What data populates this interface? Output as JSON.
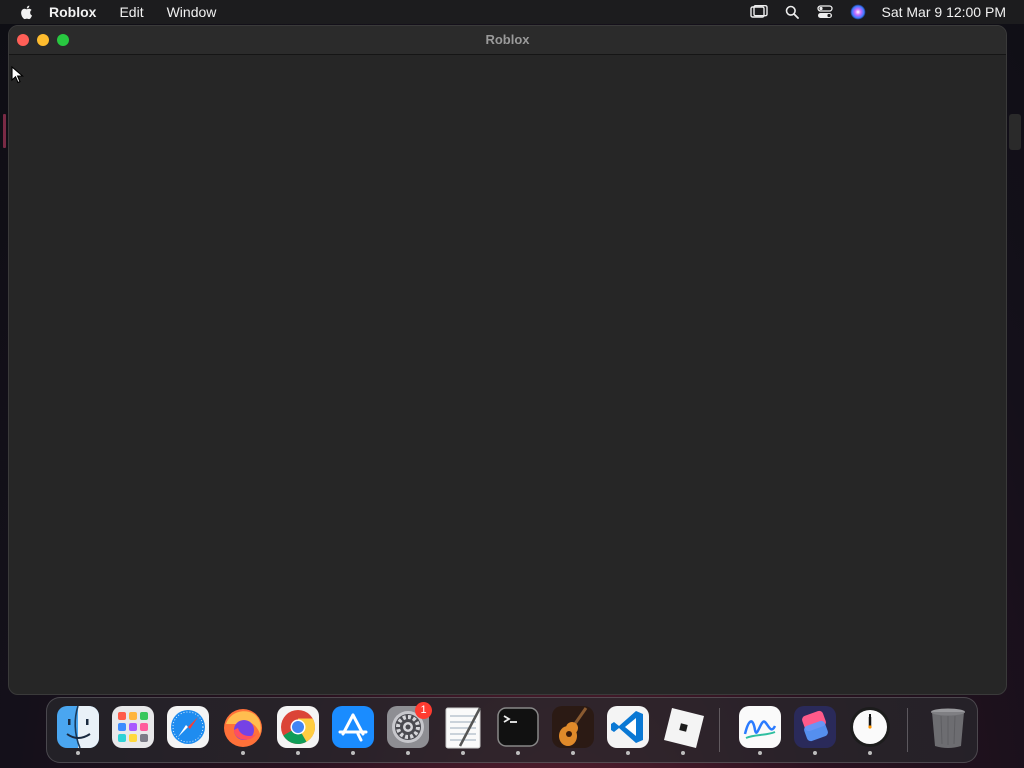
{
  "menubar": {
    "app_name": "Roblox",
    "items": [
      "Edit",
      "Window"
    ],
    "clock": "Sat Mar 9  12:00 PM",
    "status_icons": [
      "screen-mirroring-icon",
      "search-icon",
      "control-center-icon",
      "siri-icon"
    ]
  },
  "window": {
    "title": "Roblox"
  },
  "dock": {
    "apps": [
      {
        "name": "Finder",
        "icon": "finder-icon",
        "running": true
      },
      {
        "name": "Launchpad",
        "icon": "launchpad-icon",
        "running": false
      },
      {
        "name": "Safari",
        "icon": "safari-icon",
        "running": false
      },
      {
        "name": "Firefox",
        "icon": "firefox-icon",
        "running": true
      },
      {
        "name": "Chrome",
        "icon": "chrome-icon",
        "running": true
      },
      {
        "name": "App Store",
        "icon": "app-store-icon",
        "running": true
      },
      {
        "name": "System Preferences",
        "icon": "system-preferences-icon",
        "running": true,
        "badge": "1"
      },
      {
        "name": "TextEdit",
        "icon": "textedit-icon",
        "running": true
      },
      {
        "name": "Terminal",
        "icon": "terminal-icon",
        "running": true
      },
      {
        "name": "GarageBand",
        "icon": "garageband-icon",
        "running": true
      },
      {
        "name": "Visual Studio Code",
        "icon": "vscode-icon",
        "running": true
      },
      {
        "name": "Roblox",
        "icon": "roblox-icon",
        "running": true
      },
      {
        "name": "Freeform",
        "icon": "freeform-icon",
        "running": true
      },
      {
        "name": "Shortcuts",
        "icon": "shortcuts-icon",
        "running": true
      },
      {
        "name": "Clock",
        "icon": "clock-icon",
        "running": true
      },
      {
        "name": "Trash",
        "icon": "trash-icon",
        "running": false
      }
    ]
  },
  "colors": {
    "close": "#ff5f57",
    "minimize": "#febc2e",
    "maximize": "#28c840",
    "window_bg": "#262626"
  }
}
